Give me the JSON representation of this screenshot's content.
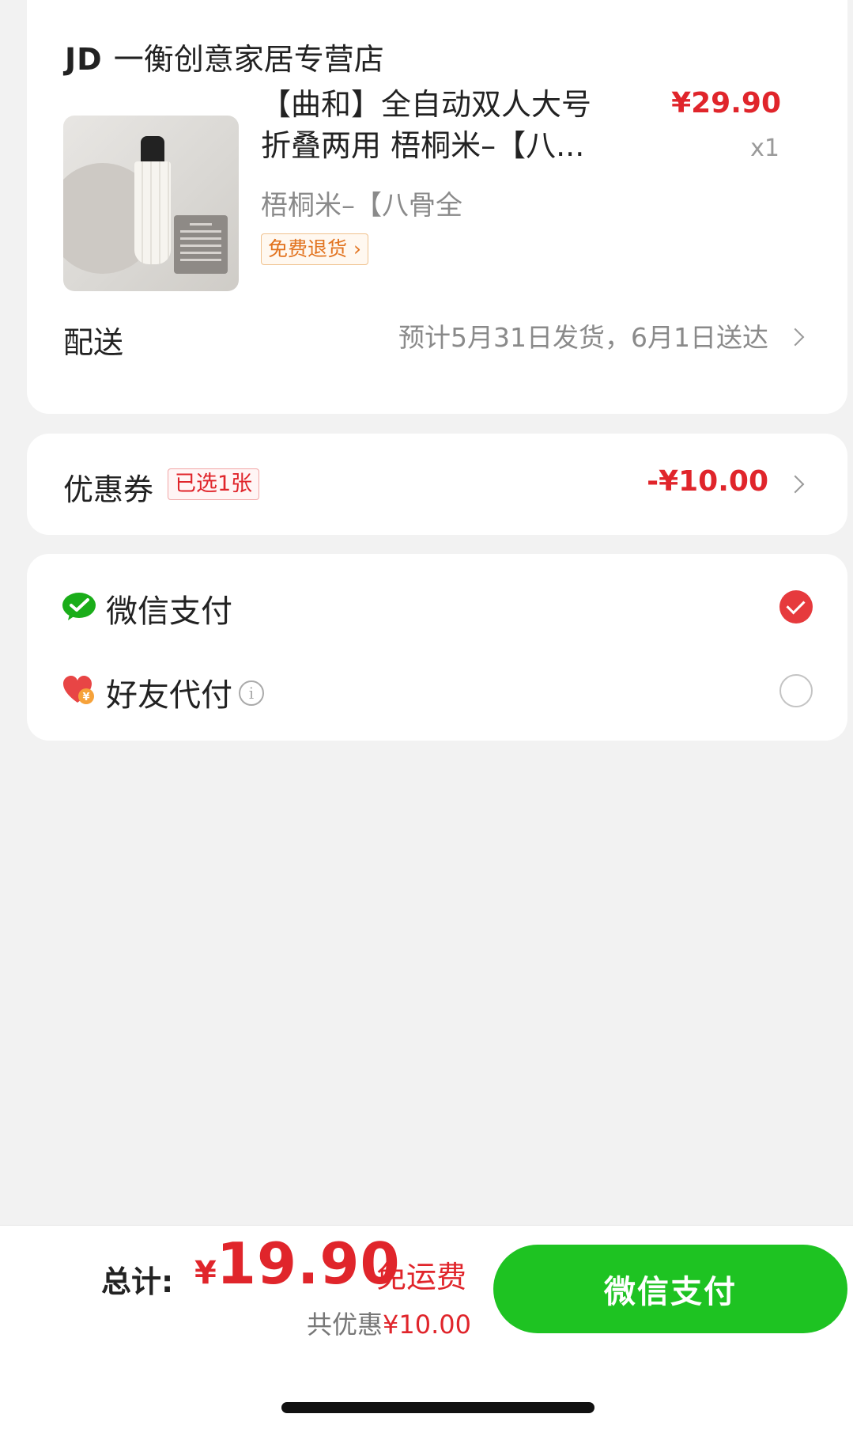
{
  "store": {
    "logo_text": "JD",
    "name": "一衡创意家居专营店"
  },
  "product": {
    "title_line1": "【曲和】全自动双人大号",
    "title_line2": "折叠两用 梧桐米–【八...",
    "spec": "梧桐米–【八骨全",
    "return_badge": "免费退货 ›",
    "price": "¥29.90",
    "quantity": "x1"
  },
  "delivery": {
    "label": "配送",
    "info": "预计5月31日发货，6月1日送达"
  },
  "coupon": {
    "label": "优惠券",
    "badge": "已选1张",
    "amount": "-¥10.00"
  },
  "payment_methods": [
    {
      "label": "微信支付",
      "selected": true,
      "icon": "wechat-pay-icon"
    },
    {
      "label": "好友代付",
      "selected": false,
      "icon": "friend-pay-heart-icon"
    }
  ],
  "summary": {
    "total_label": "总计:",
    "currency": "¥",
    "total_amount": "19.90",
    "shipping": "免运费",
    "saving_prefix": "共优惠",
    "saving_amount": "¥10.00"
  },
  "pay_button_label": "微信支付",
  "colors": {
    "accent_red": "#e0252b",
    "wechat_green": "#1ec322",
    "background": "#f2f2f2"
  }
}
